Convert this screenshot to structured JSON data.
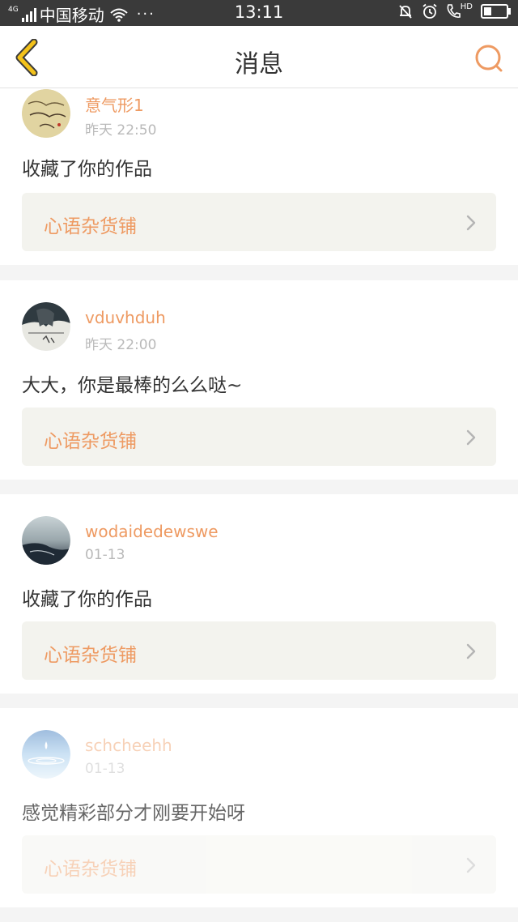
{
  "status_bar": {
    "network": "4G",
    "carrier": "中国移动",
    "dots": "···",
    "time": "13:11",
    "call_label": "HD"
  },
  "nav": {
    "title": "消息",
    "back_icon": "chevron-left-icon",
    "search_icon": "search-icon"
  },
  "colors": {
    "accent": "#ee9a62",
    "back_icon": "#f3c21a",
    "card_bg": "#ffffff",
    "shop_bg": "#f3f3ee"
  },
  "messages": [
    {
      "username": "意气形1",
      "time": "昨天 22:50",
      "text": "收藏了你的作品",
      "shop": "心语杂货铺"
    },
    {
      "username": "vduvhduh",
      "time": "昨天 22:00",
      "text": "大大，你是最棒的么么哒~",
      "shop": "心语杂货铺"
    },
    {
      "username": "wodaidedewswe",
      "time": "01-13",
      "text": "收藏了你的作品",
      "shop": "心语杂货铺"
    },
    {
      "username": "schcheehh",
      "time": "01-13",
      "text": "感觉精彩部分才刚要开始呀",
      "shop": "心语杂货铺"
    }
  ]
}
